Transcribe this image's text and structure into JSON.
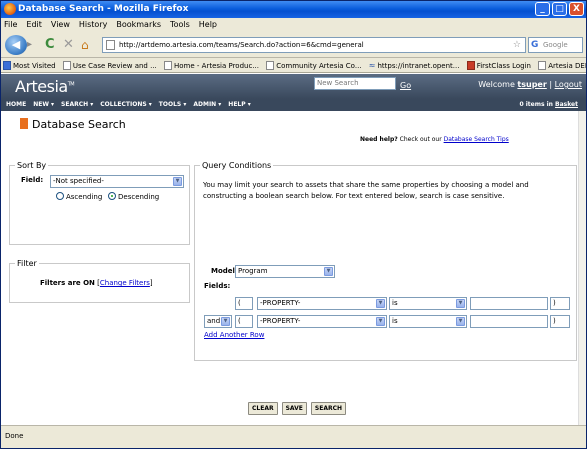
{
  "window": {
    "title": "Database Search - Mozilla Firefox",
    "min": "_",
    "max": "□",
    "close": "X"
  },
  "menu": [
    "File",
    "Edit",
    "View",
    "History",
    "Bookmarks",
    "Tools",
    "Help"
  ],
  "nav": {
    "url": "http://artdemo.artesia.com/teams/Search.do?action=6&cmd=general",
    "search_placeholder": "Google"
  },
  "bookmarks": [
    {
      "label": "Most Visited",
      "icon": "page"
    },
    {
      "label": "Use Case Review and ...",
      "icon": "page"
    },
    {
      "label": "Home - Artesia Produc...",
      "icon": "page"
    },
    {
      "label": "Community Artesia Co...",
      "icon": "page"
    },
    {
      "label": "https://intranet.opent...",
      "icon": "wave"
    },
    {
      "label": "FirstClass Login",
      "icon": "red"
    },
    {
      "label": "Artesia DEMO",
      "icon": "page"
    }
  ],
  "banner": {
    "logo": "Artesia",
    "logo_mark": "TM",
    "search_placeholder": "New Search",
    "go": "Go",
    "welcome": "Welcome",
    "user": "tsuper",
    "sep": "|",
    "logout": "Logout"
  },
  "topnav": {
    "items": [
      "HOME",
      "NEW ▾",
      "SEARCH ▾",
      "COLLECTIONS ▾",
      "TOOLS ▾",
      "ADMIN ▾",
      "HELP ▾"
    ],
    "basket_count": "0 items in",
    "basket_link": "Basket"
  },
  "page": {
    "title": "Database Search",
    "help_q": "Need help?",
    "help_text": "Check out our",
    "help_link": "Database Search Tips"
  },
  "sort": {
    "title": "Sort By",
    "field_label": "Field:",
    "field_value": "-Not specified-",
    "ascending": "Ascending",
    "descending": "Descending",
    "selected": "descending"
  },
  "filter": {
    "title": "Filter",
    "text_pre": "Filters are ON",
    "link": "Change Filters",
    "lb": "[",
    "rb": "]"
  },
  "query": {
    "title": "Query Conditions",
    "description": "You may limit your search to assets that share the same properties by choosing a model and constructing a boolean search below. For text entered below, search is case sensitive.",
    "model_label": "Model:",
    "model_value": "Program",
    "fields_label": "Fields:",
    "rows": [
      {
        "conj": "",
        "open": "(",
        "property": "-PROPERTY-",
        "op": "is",
        "value": "",
        "close": ")"
      },
      {
        "conj": "and",
        "open": "(",
        "property": "-PROPERTY-",
        "op": "is",
        "value": "",
        "close": ")"
      }
    ],
    "add_row": "Add Another Row"
  },
  "buttons": {
    "clear": "CLEAR",
    "save": "SAVE",
    "search": "SEARCH"
  },
  "status": "Done"
}
